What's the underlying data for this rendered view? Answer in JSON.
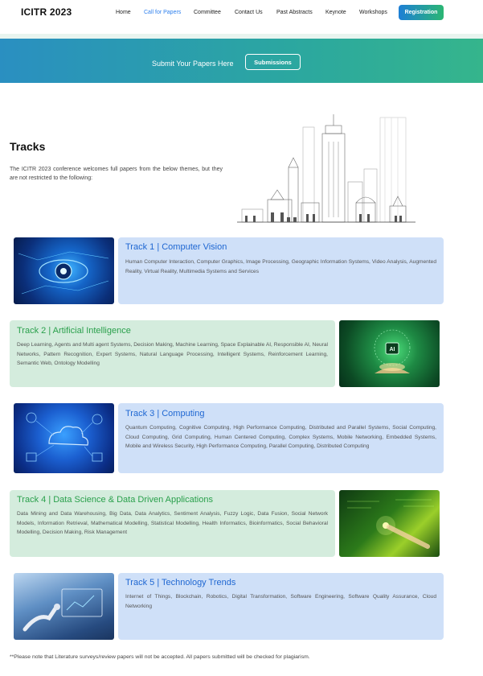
{
  "nav": {
    "brand": "ICITR 2023",
    "links": [
      "Home",
      "Call for Papers",
      "Committee",
      "Contact Us",
      "Past Abstracts",
      "Keynote",
      "Workshops"
    ],
    "active": "Call for Papers",
    "cta": "Registration"
  },
  "banner": {
    "text": "Submit Your Papers Here",
    "button": "Submissions"
  },
  "tracks_section": {
    "title": "Tracks",
    "intro": "The ICITR 2023 conference welcomes full papers from the below themes, but they are not restricted to the following:"
  },
  "tracks": [
    {
      "title": "Track 1 | Computer Vision",
      "topics": "Human Computer Interaction, Computer Graphics, Image Processing, Geographic Information Systems, Video Analysis, Augmented Reality, Virtual Reality, Multimedia Systems and Services"
    },
    {
      "title": "Track 2 | Artificial Intelligence",
      "topics": "Deep Learning, Agents and Multi agent Systems, Decision Making, Machine Learning, Space Explainable AI, Responsible AI, Neural Networks, Pattern Recognition, Expert Systems, Natural Language Processing, Intelligent Systems, Reinforcement Learning, Semantic Web, Ontology Modelling"
    },
    {
      "title": "Track 3 | Computing",
      "topics": "Quantum Computing, Cognitive Computing, High Performance Computing, Distributed and Parallel Systems, Social Computing, Cloud Computing, Grid Computing, Human Centered Computing, Complex Systems, Mobile Networking, Embedded Systems, Mobile and Wireless Security, High Performance Computing, Parallel Computing, Distributed Computing"
    },
    {
      "title": "Track 4 | Data Science & Data Driven Applications",
      "topics": "Data Mining and Data Warehousing, Big Data, Data Analytics, Sentiment Analysis, Fuzzy Logic, Data Fusion, Social Network Models, Information Retrieval, Mathematical Modelling, Statistical Modelling, Health Informatics, Bioinformatics, Social Behavioral Modelling, Decision Making, Risk Management"
    },
    {
      "title": "Track 5 | Technology Trends",
      "topics": "Internet of Things, Blockchain, Robotics, Digital Transformation, Software Engineering, Software Quality Assurance, Cloud Networking"
    }
  ],
  "footnote": "**Please note that Literature surveys/review papers will not be accepted. All papers submitted will be checked for plagiarism.",
  "colors": {
    "accent_blue": "#1f67d2",
    "accent_green": "#2aa04c",
    "card_blue": "#cfe0f8",
    "card_green": "#d4ecdd"
  },
  "icons": {
    "ai_chip": "AI"
  }
}
